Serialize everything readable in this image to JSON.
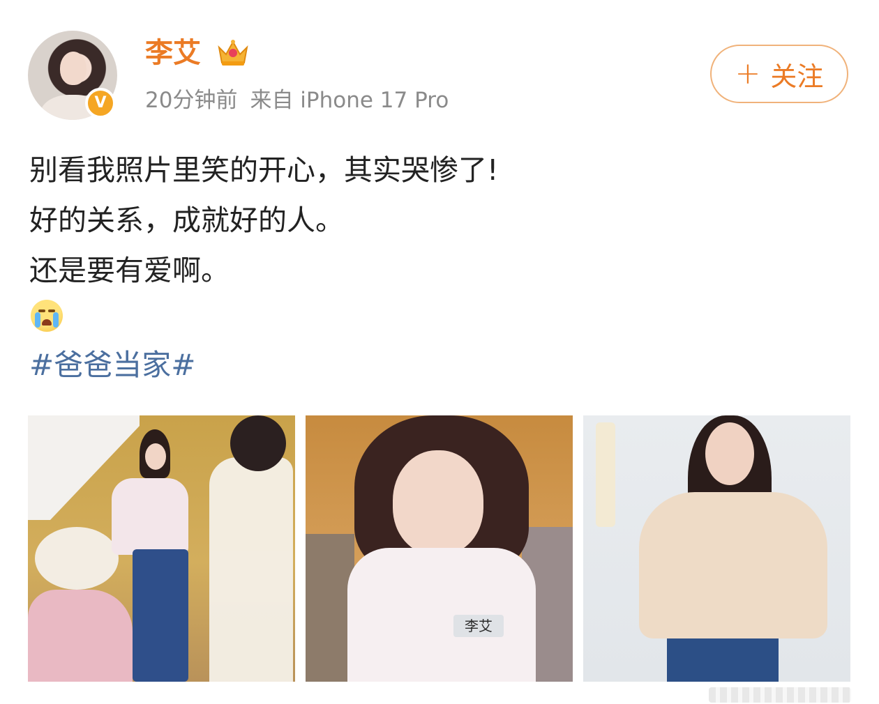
{
  "header": {
    "username": "李艾",
    "time": "20分钟前",
    "source": "来自 iPhone 17 Pro",
    "follow_label": "关注",
    "follow_icon": "plus-icon",
    "badge_icon": "crown-icon",
    "verified_icon": "verified-v-icon"
  },
  "post": {
    "lines": [
      "别看我照片里笑的开心，其实哭惨了!",
      "好的关系，成就好的人。",
      "还是要有爱啊。"
    ],
    "emoji": "crying-face-icon",
    "hashtag": "#爸爸当家#"
  },
  "photos": [
    {
      "name": "photo-1"
    },
    {
      "name": "photo-2",
      "name_tag": "李艾"
    },
    {
      "name": "photo-3"
    }
  ],
  "colors": {
    "accent": "#eb7b25",
    "hashtag": "#4b6f9f",
    "meta": "#8a8a8a"
  }
}
